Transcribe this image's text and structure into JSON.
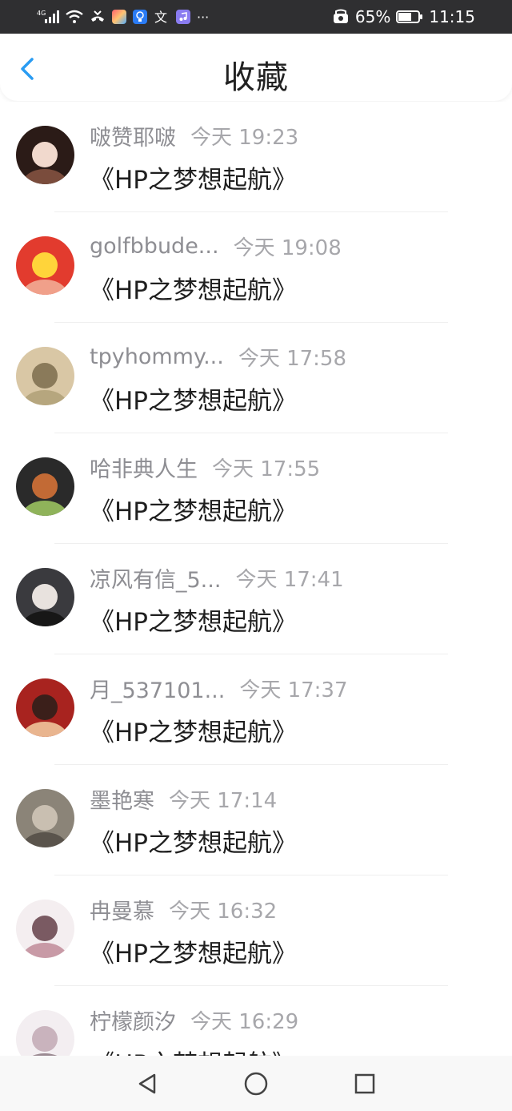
{
  "status_bar": {
    "network": "4G",
    "battery_percent_label": "65%",
    "battery_level": 0.65,
    "time": "11:15",
    "more_icons": "···",
    "icons": [
      "signal-icon",
      "wifi-icon",
      "missed-call-icon",
      "app-icon",
      "bulb-app-icon",
      "translate-icon",
      "music-app-icon",
      "alarm-icon",
      "battery-icon"
    ]
  },
  "header": {
    "back_icon": "chevron-left-icon",
    "title": "收藏"
  },
  "favorites": [
    {
      "user": "啵赞耶啵",
      "time": "今天 19:23",
      "novel": "《HP之梦想起航》",
      "avatar_colors": [
        "#2b1b17",
        "#f1d9cd",
        "#7a4c3c"
      ]
    },
    {
      "user": "golfbbude...",
      "time": "今天 19:08",
      "novel": "《HP之梦想起航》",
      "avatar_colors": [
        "#e23b2e",
        "#ffd43a",
        "#f0a08a"
      ]
    },
    {
      "user": "tpyhommy...",
      "time": "今天 17:58",
      "novel": "《HP之梦想起航》",
      "avatar_colors": [
        "#d9c7a5",
        "#8a7a5a",
        "#b6a67e"
      ]
    },
    {
      "user": "哈非典人生",
      "time": "今天 17:55",
      "novel": "《HP之梦想起航》",
      "avatar_colors": [
        "#2a2a2a",
        "#c26a35",
        "#8fb35a"
      ]
    },
    {
      "user": "凉风有信_5...",
      "time": "今天 17:41",
      "novel": "《HP之梦想起航》",
      "avatar_colors": [
        "#3a3a3e",
        "#e8e2de",
        "#171717"
      ]
    },
    {
      "user": "月_537101...",
      "time": "今天 17:37",
      "novel": "《HP之梦想起航》",
      "avatar_colors": [
        "#a8231f",
        "#3b1f1a",
        "#e9b58f"
      ]
    },
    {
      "user": "墨艳寒",
      "time": "今天 17:14",
      "novel": "《HP之梦想起航》",
      "avatar_colors": [
        "#8b8478",
        "#c9bfb1",
        "#5a544c"
      ]
    },
    {
      "user": "冉曼慕",
      "time": "今天 16:32",
      "novel": "《HP之梦想起航》",
      "avatar_colors": [
        "#f4eef0",
        "#7a5a62",
        "#c89aa6"
      ]
    },
    {
      "user": "柠檬颜汐",
      "time": "今天 16:29",
      "novel": "《HP之梦想起航》",
      "avatar_colors": [
        "#f3eef1",
        "#c9b3bd",
        "#9b8a92"
      ]
    }
  ],
  "nav_bar": {
    "icons": [
      "back-triangle-icon",
      "home-circle-icon",
      "recents-square-icon"
    ]
  }
}
